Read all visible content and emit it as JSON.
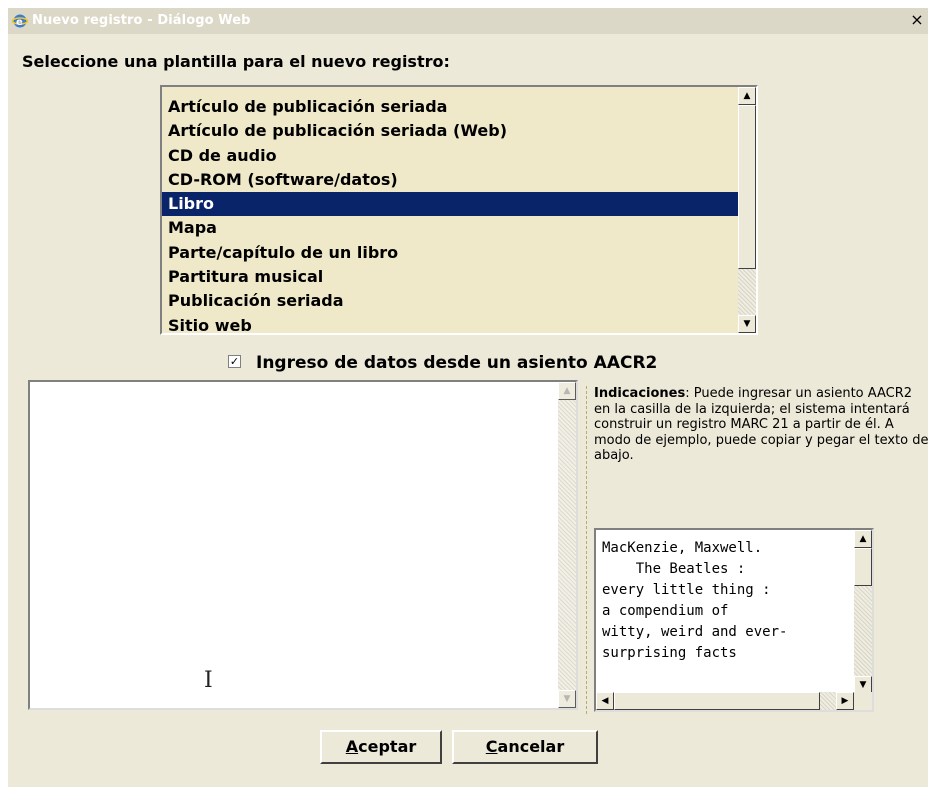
{
  "window": {
    "title": "Nuevo registro - Diálogo Web",
    "close_glyph": "×"
  },
  "prompt": "Seleccione una plantilla para el nuevo registro:",
  "templates": {
    "items": [
      "Artículo de publicación seriada",
      "Artículo de publicación seriada (Web)",
      "CD de audio",
      "CD-ROM (software/datos)",
      "Libro",
      "Mapa",
      "Parte/capítulo de un libro",
      "Partitura musical",
      "Publicación seriada",
      "Sitio web"
    ],
    "selected": "Libro"
  },
  "aacr2_checkbox": {
    "label": "Ingreso de datos desde un asiento AACR2",
    "checked": true,
    "check_glyph": "✓"
  },
  "hints": {
    "title": "Indicaciones",
    "text": ": Puede ingresar un asiento AACR2 en la casilla de la izquierda; el sistema intentará construir un registro MARC 21 a partir de él. A modo de ejemplo, puede copiar y pegar el texto de abajo."
  },
  "sample_text": "MacKenzie, Maxwell.\n    The Beatles :\nevery little thing :\na compendium of\nwitty, weird and ever-\nsurprising facts",
  "buttons": {
    "accept_first": "A",
    "accept_rest": "ceptar",
    "cancel_first": "C",
    "cancel_rest": "ancelar"
  },
  "icons": {
    "app": "ie-icon",
    "scroll_up": "▲",
    "scroll_down": "▼",
    "scroll_left": "◀",
    "scroll_right": "▶",
    "text_cursor": "I"
  },
  "colors": {
    "dialog_bg": "#ECE9D8",
    "list_bg": "#EFE9C9",
    "selection": "#0A246A"
  }
}
